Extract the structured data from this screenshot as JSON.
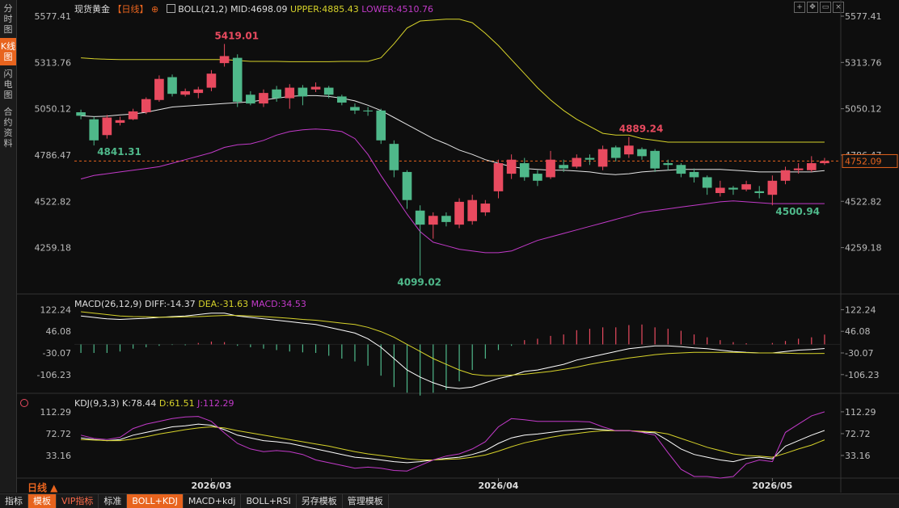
{
  "sidebar": {
    "tabs": [
      "分时图",
      "K线图",
      "闪电图",
      "合约资料"
    ],
    "active": 1
  },
  "legend": {
    "symbol": "现货黄金",
    "period": "【日线】",
    "plus": "⊕",
    "boll": "BOLL(21,2)",
    "mid": "MID:4698.09",
    "upper": "UPPER:4885.43",
    "lower": "LOWER:4510.76",
    "macd_name": "MACD(26,12,9)",
    "diff": "DIFF:-14.37",
    "dea": "DEA:-31.63",
    "macd_val": "MACD:34.53",
    "kdj_name": "KDJ(9,3,3)",
    "k": "K:78.44",
    "d": "D:61.51",
    "j": "J:112.29"
  },
  "window_icons": [
    "plus-icon",
    "move-icon",
    "restore-icon",
    "close-icon"
  ],
  "colors": {
    "up": "#e84a5f",
    "down": "#4fb88a",
    "upper": "#d7d32a",
    "mid": "#e6e6e6",
    "lower": "#c23ac9",
    "price_line": "#e8641e",
    "k": "#ffffff",
    "d": "#d7d32a",
    "j": "#c23ac9"
  },
  "bottom_tabs": [
    "指标",
    "模板",
    "VIP指标",
    "标准",
    "BOLL+KDJ",
    "MACD+kdj",
    "BOLL+RSI",
    "另存模板",
    "管理模板"
  ],
  "period_label": "日线 ▲",
  "chart_data": [
    {
      "type": "candlestick",
      "name": "price",
      "x_labels": [
        {
          "i": 10,
          "label": "2026/03"
        },
        {
          "i": 32,
          "label": "2026/04"
        },
        {
          "i": 53,
          "label": "2026/05"
        }
      ],
      "y_ticks": [
        5577.41,
        5313.76,
        5050.12,
        4786.47,
        4522.82,
        4259.18
      ],
      "ylim": [
        4059.5,
        5577.41
      ],
      "annotations": [
        {
          "i": 10,
          "value": 5419.01,
          "label": "5419.01",
          "kind": "up"
        },
        {
          "i": 1,
          "value": 4841.31,
          "label": "4841.31",
          "kind": "down"
        },
        {
          "i": 24,
          "value": 4099.02,
          "label": "4099.02",
          "kind": "down"
        },
        {
          "i": 41,
          "value": 4889.24,
          "label": "4889.24",
          "kind": "up"
        },
        {
          "i": 53,
          "value": 4500.94,
          "label": "4500.94",
          "kind": "down"
        }
      ],
      "current": {
        "value": 4752.09,
        "label": "4752.09"
      },
      "ohlc": [
        [
          5030,
          5010,
          5045,
          4990
        ],
        [
          4990,
          4870,
          5005,
          4841
        ],
        [
          4900,
          5000,
          5015,
          4880
        ],
        [
          4970,
          4985,
          5005,
          4955
        ],
        [
          4990,
          5035,
          5050,
          4985
        ],
        [
          5030,
          5105,
          5115,
          5020
        ],
        [
          5100,
          5220,
          5240,
          5090
        ],
        [
          5230,
          5135,
          5245,
          5120
        ],
        [
          5130,
          5150,
          5165,
          5120
        ],
        [
          5140,
          5160,
          5175,
          5110
        ],
        [
          5170,
          5250,
          5270,
          5150
        ],
        [
          5310,
          5350,
          5419,
          5290
        ],
        [
          5340,
          5090,
          5360,
          5060
        ],
        [
          5130,
          5080,
          5150,
          5070
        ],
        [
          5080,
          5140,
          5160,
          5060
        ],
        [
          5160,
          5110,
          5180,
          5090
        ],
        [
          5110,
          5170,
          5190,
          5050
        ],
        [
          5170,
          5120,
          5185,
          5070
        ],
        [
          5160,
          5175,
          5200,
          5145
        ],
        [
          5170,
          5130,
          5180,
          5110
        ],
        [
          5120,
          5085,
          5130,
          5070
        ],
        [
          5060,
          5040,
          5080,
          5020
        ],
        [
          5040,
          5035,
          5060,
          5010
        ],
        [
          5040,
          4870,
          5050,
          4850
        ],
        [
          4850,
          4700,
          4870,
          4660
        ],
        [
          4690,
          4530,
          4700,
          4480
        ],
        [
          4470,
          4390,
          4500,
          4099
        ],
        [
          4390,
          4440,
          4460,
          4310
        ],
        [
          4440,
          4405,
          4460,
          4380
        ],
        [
          4390,
          4520,
          4540,
          4370
        ],
        [
          4410,
          4530,
          4560,
          4390
        ],
        [
          4460,
          4510,
          4530,
          4440
        ],
        [
          4580,
          4740,
          4760,
          4540
        ],
        [
          4680,
          4760,
          4790,
          4650
        ],
        [
          4740,
          4660,
          4770,
          4640
        ],
        [
          4680,
          4640,
          4700,
          4610
        ],
        [
          4660,
          4760,
          4810,
          4650
        ],
        [
          4730,
          4710,
          4760,
          4690
        ],
        [
          4720,
          4770,
          4790,
          4710
        ],
        [
          4770,
          4760,
          4790,
          4730
        ],
        [
          4720,
          4820,
          4840,
          4700
        ],
        [
          4830,
          4770,
          4840,
          4750
        ],
        [
          4790,
          4840,
          4889,
          4770
        ],
        [
          4820,
          4780,
          4830,
          4760
        ],
        [
          4810,
          4710,
          4820,
          4690
        ],
        [
          4740,
          4730,
          4760,
          4700
        ],
        [
          4730,
          4680,
          4740,
          4660
        ],
        [
          4690,
          4660,
          4710,
          4630
        ],
        [
          4660,
          4600,
          4670,
          4560
        ],
        [
          4570,
          4600,
          4640,
          4550
        ],
        [
          4600,
          4590,
          4610,
          4560
        ],
        [
          4590,
          4620,
          4640,
          4580
        ],
        [
          4580,
          4570,
          4610,
          4540
        ],
        [
          4560,
          4640,
          4670,
          4500
        ],
        [
          4640,
          4700,
          4720,
          4620
        ],
        [
          4700,
          4710,
          4740,
          4680
        ],
        [
          4700,
          4740,
          4780,
          4690
        ],
        [
          4740,
          4752,
          4770,
          4730
        ]
      ],
      "series": [
        {
          "name": "UPPER",
          "values": [
            5340,
            5335,
            5332,
            5330,
            5330,
            5330,
            5330,
            5330,
            5330,
            5330,
            5330,
            5330,
            5325,
            5320,
            5320,
            5320,
            5318,
            5318,
            5318,
            5318,
            5320,
            5320,
            5320,
            5340,
            5420,
            5510,
            5550,
            5555,
            5560,
            5560,
            5540,
            5480,
            5410,
            5330,
            5250,
            5170,
            5100,
            5040,
            4990,
            4950,
            4910,
            4900,
            4900,
            4880,
            4870,
            4860,
            4860,
            4860,
            4860,
            4860,
            4860,
            4860,
            4860,
            4860,
            4860,
            4860,
            4860,
            4860
          ]
        },
        {
          "name": "MID",
          "values": [
            5010,
            5005,
            5008,
            5015,
            5020,
            5030,
            5045,
            5060,
            5065,
            5070,
            5075,
            5080,
            5085,
            5090,
            5100,
            5110,
            5120,
            5125,
            5125,
            5120,
            5110,
            5095,
            5070,
            5040,
            5000,
            4960,
            4920,
            4880,
            4850,
            4815,
            4790,
            4760,
            4740,
            4720,
            4710,
            4705,
            4700,
            4700,
            4695,
            4690,
            4680,
            4675,
            4680,
            4690,
            4695,
            4700,
            4705,
            4705,
            4705,
            4705,
            4700,
            4695,
            4690,
            4690,
            4690,
            4690,
            4690,
            4698
          ]
        },
        {
          "name": "LOWER",
          "values": [
            4650,
            4670,
            4680,
            4690,
            4700,
            4710,
            4720,
            4740,
            4760,
            4780,
            4800,
            4830,
            4845,
            4850,
            4870,
            4900,
            4920,
            4930,
            4935,
            4930,
            4920,
            4880,
            4790,
            4670,
            4560,
            4450,
            4350,
            4290,
            4270,
            4250,
            4240,
            4230,
            4230,
            4240,
            4270,
            4300,
            4320,
            4340,
            4360,
            4380,
            4400,
            4420,
            4440,
            4460,
            4470,
            4480,
            4490,
            4500,
            4510,
            4520,
            4525,
            4520,
            4515,
            4510,
            4510,
            4510,
            4510,
            4510
          ]
        }
      ]
    },
    {
      "type": "macd",
      "name": "macd",
      "y_ticks": [
        122.24,
        46.08,
        -30.07,
        -106.23
      ],
      "ylim": [
        -175,
        132
      ],
      "diff": [
        100,
        95,
        90,
        88,
        90,
        92,
        95,
        98,
        100,
        105,
        110,
        110,
        100,
        95,
        90,
        85,
        80,
        75,
        70,
        60,
        50,
        40,
        20,
        -10,
        -50,
        -90,
        -115,
        -135,
        -150,
        -155,
        -150,
        -135,
        -120,
        -110,
        -95,
        -90,
        -80,
        -70,
        -55,
        -45,
        -35,
        -25,
        -15,
        -10,
        -5,
        -5,
        -8,
        -12,
        -15,
        -20,
        -25,
        -28,
        -30,
        -30,
        -25,
        -20,
        -18,
        -14.37
      ],
      "dea": [
        115,
        110,
        105,
        100,
        98,
        97,
        96,
        96,
        97,
        98,
        100,
        102,
        102,
        100,
        98,
        95,
        92,
        88,
        85,
        80,
        75,
        70,
        60,
        45,
        25,
        0,
        -25,
        -50,
        -70,
        -90,
        -105,
        -110,
        -110,
        -108,
        -105,
        -100,
        -95,
        -88,
        -80,
        -70,
        -62,
        -55,
        -48,
        -42,
        -36,
        -32,
        -30,
        -28,
        -28,
        -28,
        -28,
        -29,
        -30,
        -30,
        -31,
        -32,
        -32,
        -31.63
      ],
      "hist": [
        -30,
        -30,
        -30,
        -25,
        -15,
        -10,
        -5,
        -2,
        -3,
        5,
        10,
        8,
        -5,
        -10,
        -15,
        -20,
        -25,
        -28,
        -30,
        -40,
        -50,
        -60,
        -75,
        -110,
        -150,
        -170,
        -180,
        -170,
        -160,
        -130,
        -90,
        -50,
        -20,
        -5,
        15,
        20,
        30,
        35,
        50,
        55,
        60,
        60,
        68,
        70,
        60,
        55,
        48,
        35,
        25,
        15,
        8,
        4,
        0,
        5,
        12,
        20,
        25,
        34.53
      ]
    },
    {
      "type": "kdj",
      "name": "kdj",
      "y_ticks": [
        112.29,
        72.72,
        33.16
      ],
      "ylim": [
        -5,
        118
      ],
      "k": [
        65,
        62,
        60,
        62,
        70,
        75,
        80,
        85,
        87,
        90,
        88,
        80,
        70,
        65,
        60,
        58,
        55,
        50,
        45,
        40,
        35,
        30,
        28,
        25,
        22,
        20,
        22,
        25,
        28,
        30,
        35,
        42,
        55,
        65,
        70,
        72,
        75,
        78,
        80,
        82,
        80,
        78,
        78,
        76,
        74,
        60,
        45,
        35,
        30,
        25,
        22,
        28,
        30,
        27,
        50,
        60,
        70,
        78.44
      ],
      "d": [
        62,
        61,
        60,
        60,
        63,
        67,
        72,
        76,
        80,
        83,
        85,
        83,
        78,
        74,
        70,
        66,
        62,
        58,
        54,
        50,
        45,
        40,
        36,
        33,
        30,
        27,
        25,
        25,
        26,
        27,
        30,
        34,
        41,
        49,
        56,
        61,
        66,
        70,
        73,
        76,
        78,
        78,
        78,
        77,
        76,
        72,
        64,
        56,
        48,
        42,
        36,
        33,
        32,
        30,
        37,
        45,
        52,
        61.51
      ],
      "j": [
        70,
        64,
        62,
        66,
        82,
        90,
        95,
        100,
        103,
        104,
        95,
        74,
        55,
        45,
        40,
        42,
        40,
        35,
        25,
        20,
        15,
        10,
        12,
        10,
        6,
        5,
        15,
        25,
        32,
        36,
        45,
        58,
        85,
        100,
        98,
        95,
        95,
        95,
        95,
        94,
        85,
        78,
        78,
        75,
        70,
        38,
        8,
        -5,
        -5,
        -8,
        -5,
        18,
        25,
        22,
        75,
        90,
        105,
        112.29
      ]
    }
  ]
}
